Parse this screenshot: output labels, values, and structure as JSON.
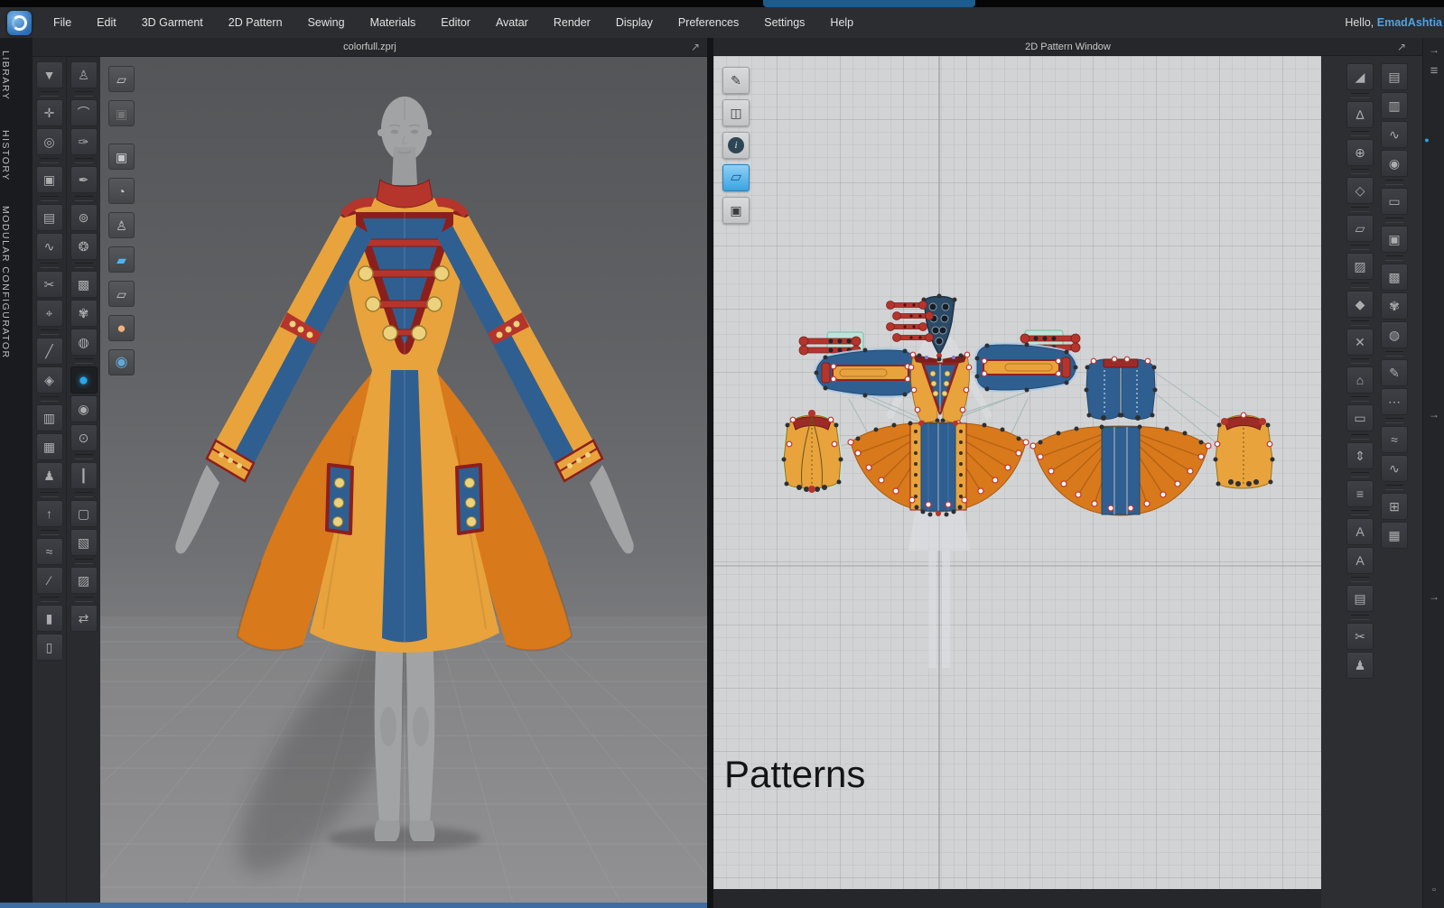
{
  "os": {
    "strip_note": "background-window-edge"
  },
  "menu_bar": {
    "items": [
      {
        "n": "menu-file",
        "label": "File"
      },
      {
        "n": "menu-edit",
        "label": "Edit"
      },
      {
        "n": "menu-3d-garment",
        "label": "3D Garment"
      },
      {
        "n": "menu-2d-pattern",
        "label": "2D Pattern"
      },
      {
        "n": "menu-sewing",
        "label": "Sewing"
      },
      {
        "n": "menu-materials",
        "label": "Materials"
      },
      {
        "n": "menu-editor",
        "label": "Editor"
      },
      {
        "n": "menu-avatar",
        "label": "Avatar"
      },
      {
        "n": "menu-render",
        "label": "Render"
      },
      {
        "n": "menu-display",
        "label": "Display"
      },
      {
        "n": "menu-preferences",
        "label": "Preferences"
      },
      {
        "n": "menu-settings",
        "label": "Settings"
      },
      {
        "n": "menu-help",
        "label": "Help"
      }
    ],
    "greeting": "Hello, ",
    "username": "EmadAshtia"
  },
  "side_tabs": {
    "items": [
      {
        "n": "tab-library",
        "label": "LIBRARY"
      },
      {
        "n": "tab-history",
        "label": "HISTORY"
      },
      {
        "n": "tab-modular-configurator",
        "label": "MODULAR CONFIGURATOR"
      }
    ]
  },
  "window_3d": {
    "title": "colorfull.zprj"
  },
  "window_2d": {
    "title": "2D Pattern Window",
    "annotation": "Patterns"
  },
  "icons": {
    "popout": "↗"
  },
  "farstrip": {
    "collapse_arrow": "→",
    "menu_icon": "≡",
    "notify_dot": "●",
    "mid_arrow": "→",
    "low_arrow": "→",
    "corner": "▫"
  },
  "tools": {
    "col1": [
      {
        "n": "tool-simulate",
        "g": "▼"
      },
      {
        "sep": true
      },
      {
        "n": "tool-transform",
        "g": "✛"
      },
      {
        "n": "tool-select-lasso",
        "g": "◎"
      },
      {
        "sep": true
      },
      {
        "n": "tool-select-mesh",
        "g": "▣"
      },
      {
        "sep": true
      },
      {
        "n": "tool-segment-sewing",
        "g": "▤"
      },
      {
        "n": "tool-free-sewing",
        "g": "∿"
      },
      {
        "sep": true
      },
      {
        "n": "tool-edit-sewing",
        "g": "✂"
      },
      {
        "n": "tool-tack",
        "g": "⌖"
      },
      {
        "sep": true
      },
      {
        "n": "tool-pin",
        "g": "╱"
      },
      {
        "n": "tool-fold-arrangement",
        "g": "◈"
      },
      {
        "sep": true
      },
      {
        "n": "tool-solidify",
        "g": "▥"
      },
      {
        "n": "tool-layer-clone",
        "g": "▦"
      },
      {
        "n": "tool-fit-to-avatar",
        "g": "♟"
      },
      {
        "sep": true
      },
      {
        "n": "tool-grade",
        "g": "↑"
      },
      {
        "sep": true
      },
      {
        "n": "tool-measure-tape",
        "g": "≈"
      },
      {
        "n": "tool-ruler",
        "g": "∕"
      },
      {
        "sep": true
      },
      {
        "n": "tool-basting",
        "g": "▮"
      },
      {
        "n": "tool-remove-basting",
        "g": "▯"
      }
    ],
    "col2": [
      {
        "n": "tool-avatar-walk",
        "g": "♙"
      },
      {
        "sep": true
      },
      {
        "n": "tool-avatar-tape",
        "g": "⌒"
      },
      {
        "n": "tool-avatar-pen",
        "g": "✑"
      },
      {
        "sep": true
      },
      {
        "n": "tool-avatar-measure",
        "g": "✒"
      },
      {
        "sep": true
      },
      {
        "n": "tool-stitch-edit",
        "g": "⊚"
      },
      {
        "n": "tool-stitch-shirt",
        "g": "❂"
      },
      {
        "sep": true
      },
      {
        "n": "tool-fabric-roll",
        "g": "▩"
      },
      {
        "n": "tool-texture-shirt",
        "g": "✾"
      },
      {
        "n": "tool-pattern-shirt",
        "g": "◍"
      },
      {
        "sep": true
      },
      {
        "n": "tool-3d-paint",
        "g": "●",
        "cls": "active-blue"
      },
      {
        "n": "tool-button",
        "g": "◉"
      },
      {
        "n": "tool-buttonhole",
        "g": "⊙"
      },
      {
        "sep": true
      },
      {
        "n": "tool-zipper",
        "g": "┃"
      },
      {
        "sep": true
      },
      {
        "n": "tool-fabric-a",
        "g": "▢"
      },
      {
        "n": "tool-fabric-b",
        "g": "▧"
      },
      {
        "sep": true
      },
      {
        "n": "tool-fabric-c",
        "g": "▨"
      },
      {
        "sep": true
      },
      {
        "n": "tool-pleats",
        "g": "⇄"
      }
    ],
    "view": [
      {
        "n": "view-gizmo",
        "g": "▱"
      },
      {
        "n": "view-garment-ghost",
        "g": "▣",
        "cls": "dim"
      },
      {
        "sep": true
      },
      {
        "n": "view-garment",
        "g": "▣"
      },
      {
        "n": "view-points",
        "g": "◔"
      },
      {
        "n": "view-avatar",
        "g": "♙"
      },
      {
        "n": "view-fabric-on",
        "g": "▰",
        "cls": "blue-icon"
      },
      {
        "n": "view-fabric-off",
        "g": "▱"
      },
      {
        "n": "view-head",
        "g": "●",
        "cls": "orange-icon"
      },
      {
        "n": "view-globe",
        "g": "◉",
        "cls": "globe-icon"
      }
    ],
    "pattern2d": [
      {
        "n": "p2d-show-seams",
        "g": "✎"
      },
      {
        "n": "p2d-show-garment",
        "g": "◫"
      },
      {
        "n": "p2d-info",
        "g": "i",
        "cls": "info"
      },
      {
        "n": "p2d-show-pattern",
        "g": "▱",
        "cls": "blue-sel"
      },
      {
        "n": "p2d-lock",
        "g": "▣",
        "cls": "dim"
      }
    ],
    "right1": [
      {
        "n": "r-transform-pattern",
        "g": "◢"
      },
      {
        "sep": true
      },
      {
        "n": "r-edit-curve",
        "g": "∆"
      },
      {
        "sep": true
      },
      {
        "n": "r-edit-points",
        "g": "⊕"
      },
      {
        "sep": true
      },
      {
        "n": "r-shape",
        "g": "◇"
      },
      {
        "sep": true
      },
      {
        "n": "r-pattern-outline",
        "g": "▱"
      },
      {
        "sep": true
      },
      {
        "n": "r-trace",
        "g": "▨"
      },
      {
        "sep": true
      },
      {
        "n": "r-pocket",
        "g": "◆"
      },
      {
        "sep": true
      },
      {
        "n": "r-cross",
        "g": "✕"
      },
      {
        "sep": true
      },
      {
        "n": "r-polygon",
        "g": "⌂"
      },
      {
        "sep": true
      },
      {
        "n": "r-rect",
        "g": "▭"
      },
      {
        "sep": true
      },
      {
        "n": "r-ruler-v",
        "g": "⇕"
      },
      {
        "sep": true
      },
      {
        "n": "r-ruler-h",
        "g": "≡"
      },
      {
        "sep": true
      },
      {
        "n": "r-text",
        "g": "A"
      },
      {
        "n": "r-text-style",
        "g": "A"
      },
      {
        "sep": true
      },
      {
        "n": "r-seam-allowance",
        "g": "▤"
      },
      {
        "sep": true
      },
      {
        "n": "r-cut-and-sew",
        "g": "✂"
      },
      {
        "n": "r-avatar-pair",
        "g": "♟"
      }
    ],
    "right2": [
      {
        "n": "r2-segment-sew",
        "g": "▤"
      },
      {
        "n": "r2-free-sew",
        "g": "▥"
      },
      {
        "n": "r2-mn-sew",
        "g": "∿"
      },
      {
        "n": "r2-sew-detail",
        "g": "◉"
      },
      {
        "sep": true
      },
      {
        "n": "r2-iron",
        "g": "▭"
      },
      {
        "sep": true
      },
      {
        "n": "r2-shirt",
        "g": "▣"
      },
      {
        "sep": true
      },
      {
        "n": "r2-fabric-roll",
        "g": "▩"
      },
      {
        "n": "r2-texture-shirt",
        "g": "✾"
      },
      {
        "n": "r2-checker-shirt",
        "g": "◍"
      },
      {
        "sep": true
      },
      {
        "n": "r2-pen-line",
        "g": "✎"
      },
      {
        "n": "r2-dotted-line",
        "g": "⋯"
      },
      {
        "sep": true
      },
      {
        "n": "r2-zigzag-a",
        "g": "≈"
      },
      {
        "n": "r2-zigzag-b",
        "g": "∿"
      },
      {
        "sep": true
      },
      {
        "n": "r2-add-pattern",
        "g": "⊞"
      },
      {
        "n": "r2-bundle",
        "g": "▦"
      }
    ]
  },
  "colors": {
    "yellow": "#e8a33c",
    "blue": "#2f5f91",
    "orange": "#d8791c",
    "red": "#b5342c",
    "darkred": "#8c1f1c",
    "navy": "#2a4a66",
    "gold": "#ecd27c",
    "skin": "#a2a3a5",
    "accent": "#2aa7e8",
    "username": "#4fa3e3",
    "selhalo": "#a7cbe8",
    "selteal": "#bfe3d8"
  }
}
